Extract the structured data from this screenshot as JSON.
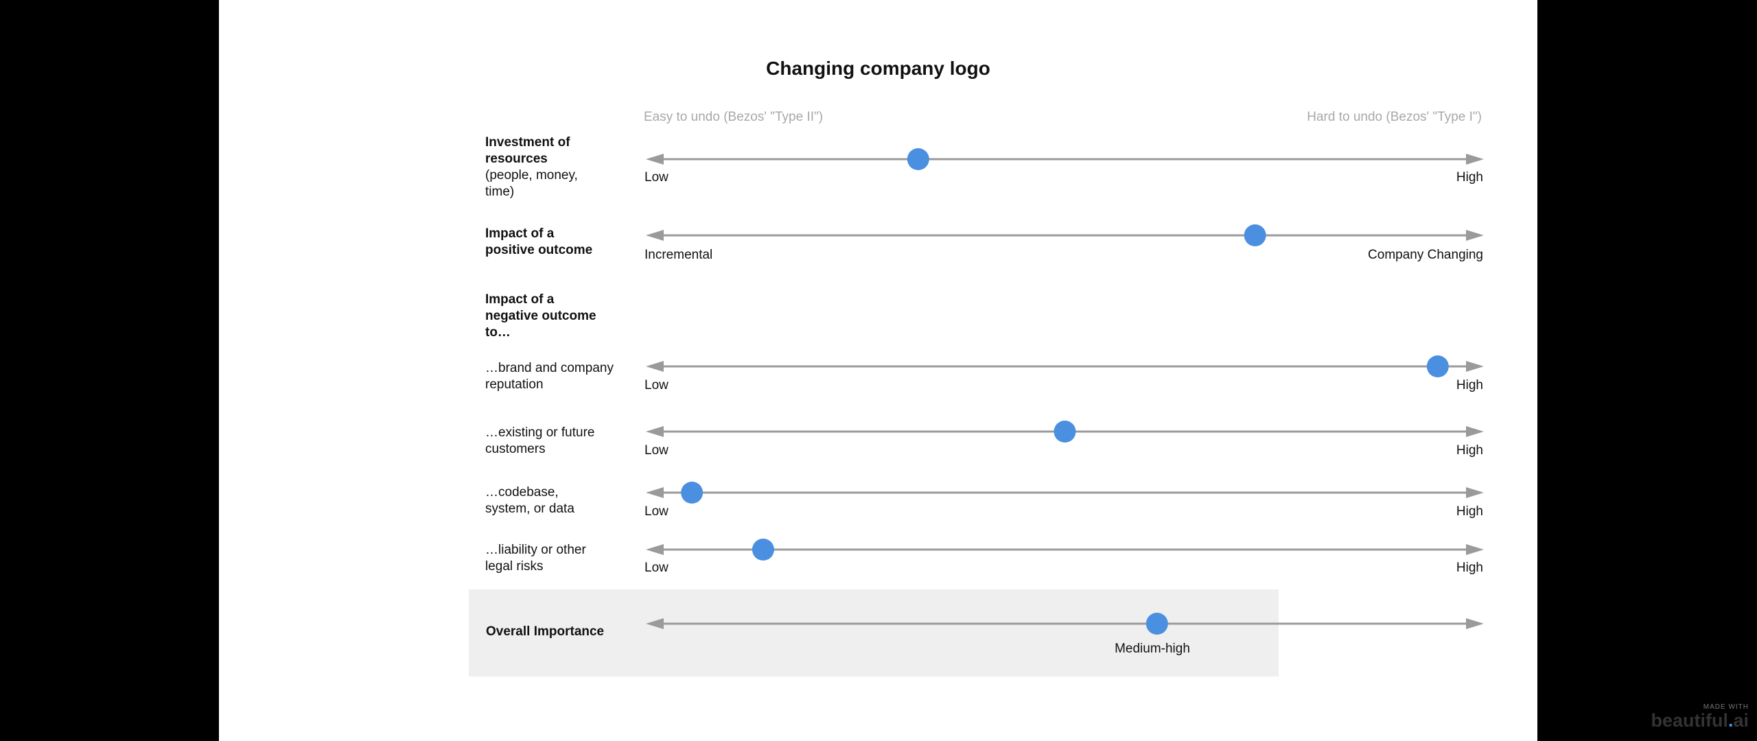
{
  "title": "Changing company logo",
  "axis_hints": {
    "left": "Easy to undo (Bezos' \"Type II\")",
    "right": "Hard to undo (Bezos' \"Type I\")"
  },
  "colors": {
    "dot": "#4a8fe0",
    "axis": "#9a9a9a",
    "band": "#efefef"
  },
  "section_heading": {
    "bold": "Impact of a negative outcome to…"
  },
  "rows": [
    {
      "id": "investment",
      "label_bold": "Investment of resources",
      "label_rest": "(people, money, time)",
      "left": "Low",
      "right": "High",
      "value": 0.325
    },
    {
      "id": "positive",
      "label_bold": "Impact of a positive outcome",
      "label_rest": "",
      "left": "Incremental",
      "right": "Company Changing",
      "value": 0.727
    },
    {
      "id": "brand",
      "label_bold": "",
      "label_rest": "…brand and company reputation",
      "left": "Low",
      "right": "High",
      "value": 0.945
    },
    {
      "id": "customers",
      "label_bold": "",
      "label_rest": "…existing or future customers",
      "left": "Low",
      "right": "High",
      "value": 0.5
    },
    {
      "id": "codebase",
      "label_bold": "",
      "label_rest": "…codebase, system, or data",
      "left": "Low",
      "right": "High",
      "value": 0.055
    },
    {
      "id": "liability",
      "label_bold": "",
      "label_rest": "…liability or other legal risks",
      "left": "Low",
      "right": "High",
      "value": 0.14
    },
    {
      "id": "overall",
      "label_bold": "Overall Importance",
      "label_rest": "",
      "left": "",
      "right": "",
      "center": "Medium-high",
      "value": 0.61
    }
  ],
  "brand": {
    "made_with": "MADE WITH",
    "name_a": "beautiful",
    "name_dot": ".",
    "name_b": "ai"
  }
}
